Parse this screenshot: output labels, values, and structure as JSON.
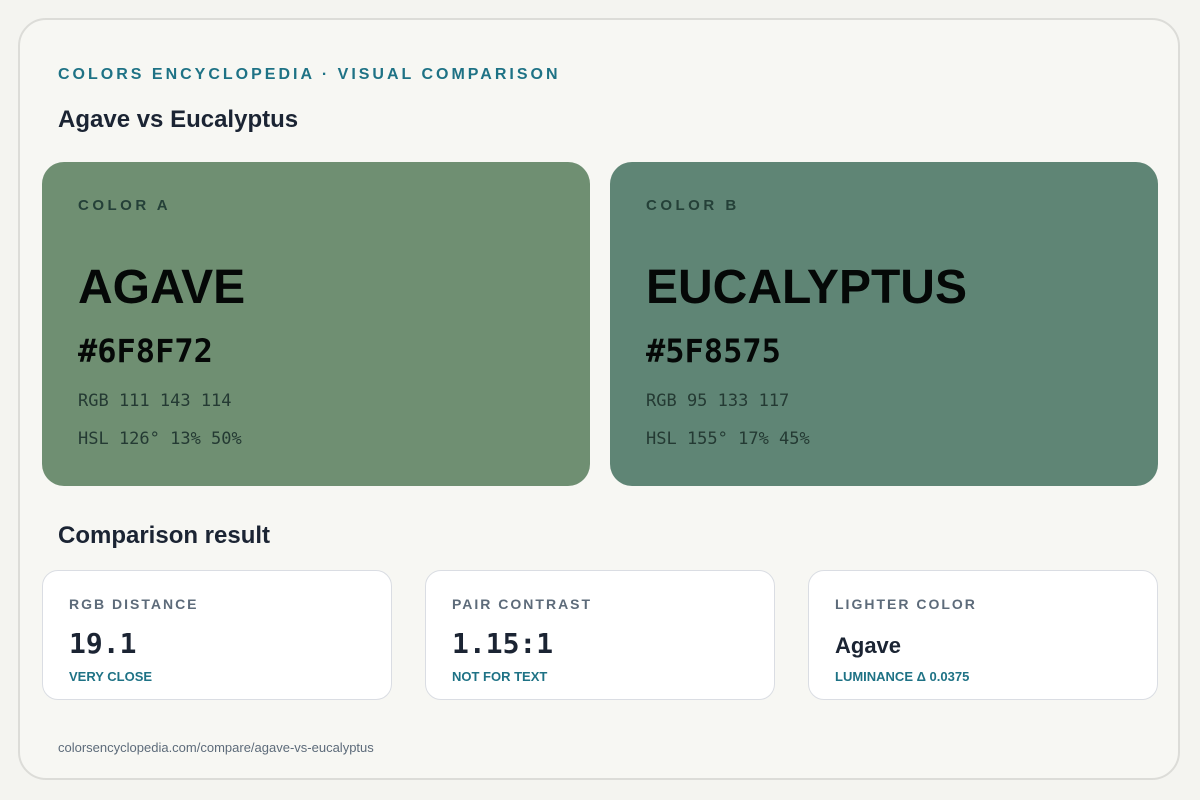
{
  "header": {
    "eyebrow": "COLORS ENCYCLOPEDIA · VISUAL COMPARISON",
    "title": "Agave vs Eucalyptus"
  },
  "colors": {
    "a": {
      "label": "COLOR A",
      "name": "AGAVE",
      "hex": "#6F8F72",
      "rgb": "RGB 111 143 114",
      "hsl": "HSL 126° 13% 50%"
    },
    "b": {
      "label": "COLOR B",
      "name": "EUCALYPTUS",
      "hex": "#5F8575",
      "rgb": "RGB 95 133 117",
      "hsl": "HSL 155° 17% 45%"
    }
  },
  "comparison": {
    "title": "Comparison result",
    "cards": [
      {
        "label": "RGB DISTANCE",
        "value": "19.1",
        "note": "VERY CLOSE"
      },
      {
        "label": "PAIR CONTRAST",
        "value": "1.15:1",
        "note": "NOT FOR TEXT"
      },
      {
        "label": "LIGHTER COLOR",
        "value": "Agave",
        "note": "LUMINANCE Δ 0.0375"
      }
    ]
  },
  "footer": {
    "url": "colorsencyclopedia.com/compare/agave-vs-eucalyptus"
  },
  "theme": {
    "accent": "#1e7285",
    "background": "#f7f7f3"
  }
}
